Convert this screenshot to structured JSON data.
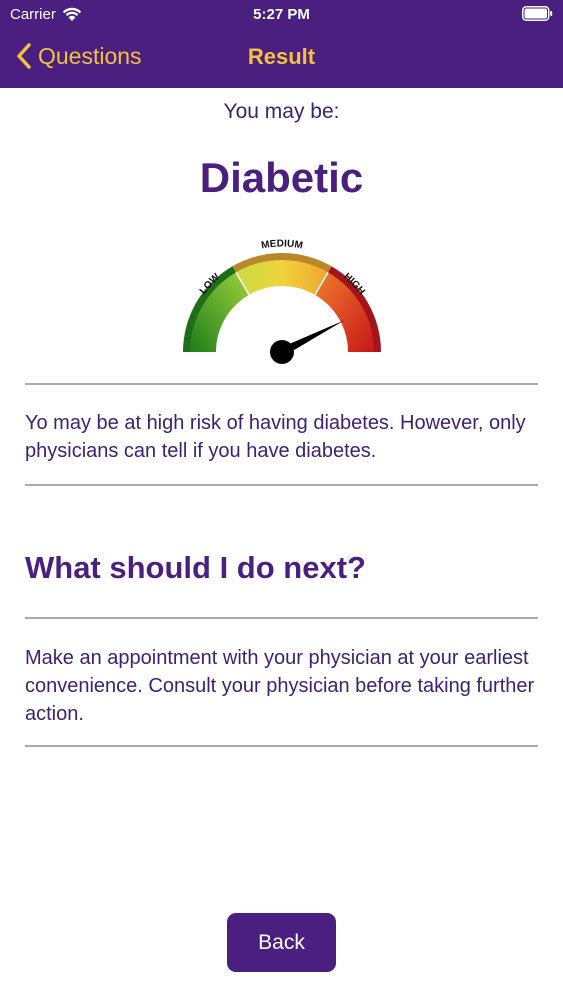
{
  "status_bar": {
    "carrier": "Carrier",
    "time": "5:27 PM"
  },
  "nav": {
    "back_label": "Questions",
    "title": "Result"
  },
  "result": {
    "intro": "You may be:",
    "title": "Diabetic"
  },
  "gauge": {
    "labels": [
      "LOW",
      "MEDIUM",
      "HIGH"
    ],
    "level": 0.85,
    "colors": {
      "low": "#2f9e2c",
      "medium": "#e5c23a",
      "high": "#dc3a1f"
    }
  },
  "description": "Yo may be at high risk of having diabetes. However, only physicians can tell if you have diabetes.",
  "next_steps": {
    "heading": "What should I do next?",
    "text": "Make an appointment with your physician at your earliest convenience. Consult your physician before taking further action."
  },
  "footer": {
    "back_button_label": "Back"
  },
  "theme": {
    "primary": "#4a1f80",
    "accent": "#f2c23e"
  }
}
